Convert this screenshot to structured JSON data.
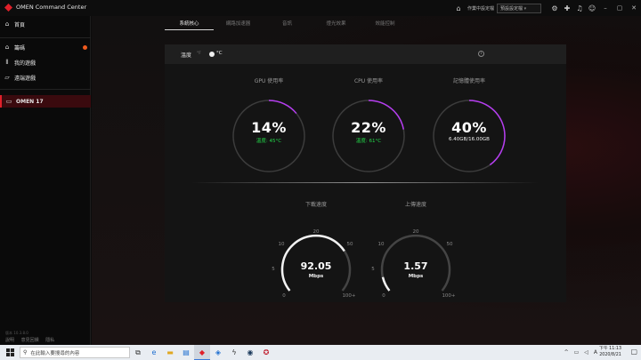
{
  "window": {
    "title": "OMEN Command Center",
    "mode_select": "作業中設定檔",
    "profile_select": "預設設定檔",
    "accent": "#e0202a"
  },
  "sidebar": {
    "home": "首頁",
    "items": [
      {
        "label": "籌碼",
        "icon": "tag-icon"
      },
      {
        "label": "我的遊戲",
        "icon": "library-icon"
      },
      {
        "label": "遠端遊戲",
        "icon": "remote-icon"
      }
    ],
    "device": "OMEN 17",
    "version": "版本 10.3.8.0",
    "footer_links": [
      "說明",
      "意見回饋",
      "隱私"
    ]
  },
  "tabs": [
    "系統核心",
    "網路加速器",
    "音訊",
    "燈光效果",
    "效能控制"
  ],
  "active_tab": 0,
  "temperature": {
    "label": "溫度",
    "unit_f": "°F",
    "unit_c": "°C"
  },
  "gauges": [
    {
      "label": "GPU 使用率",
      "value": "14%",
      "sub": "溫度: 45°C",
      "percent": 14,
      "sub_color": "green"
    },
    {
      "label": "CPU 使用率",
      "value": "22%",
      "sub": "溫度: 61°C",
      "percent": 22,
      "sub_color": "green"
    },
    {
      "label": "記憶體使用率",
      "value": "40%",
      "sub": "6.40GB/16.00GB",
      "percent": 40,
      "sub_color": "white"
    }
  ],
  "dials": [
    {
      "label": "下載速度",
      "value": "92.05",
      "unit": "Mbps",
      "ticks": [
        "0",
        "5",
        "10",
        "20",
        "50",
        "100+"
      ],
      "level": 0.72
    },
    {
      "label": "上傳速度",
      "value": "1.57",
      "unit": "Mbps",
      "ticks": [
        "0",
        "5",
        "10",
        "20",
        "50",
        "100+"
      ],
      "level": 0.1
    }
  ],
  "taskbar": {
    "search_placeholder": "在此輸入要搜尋的內容",
    "time": "下午 11:13",
    "date": "2020/8/21"
  }
}
